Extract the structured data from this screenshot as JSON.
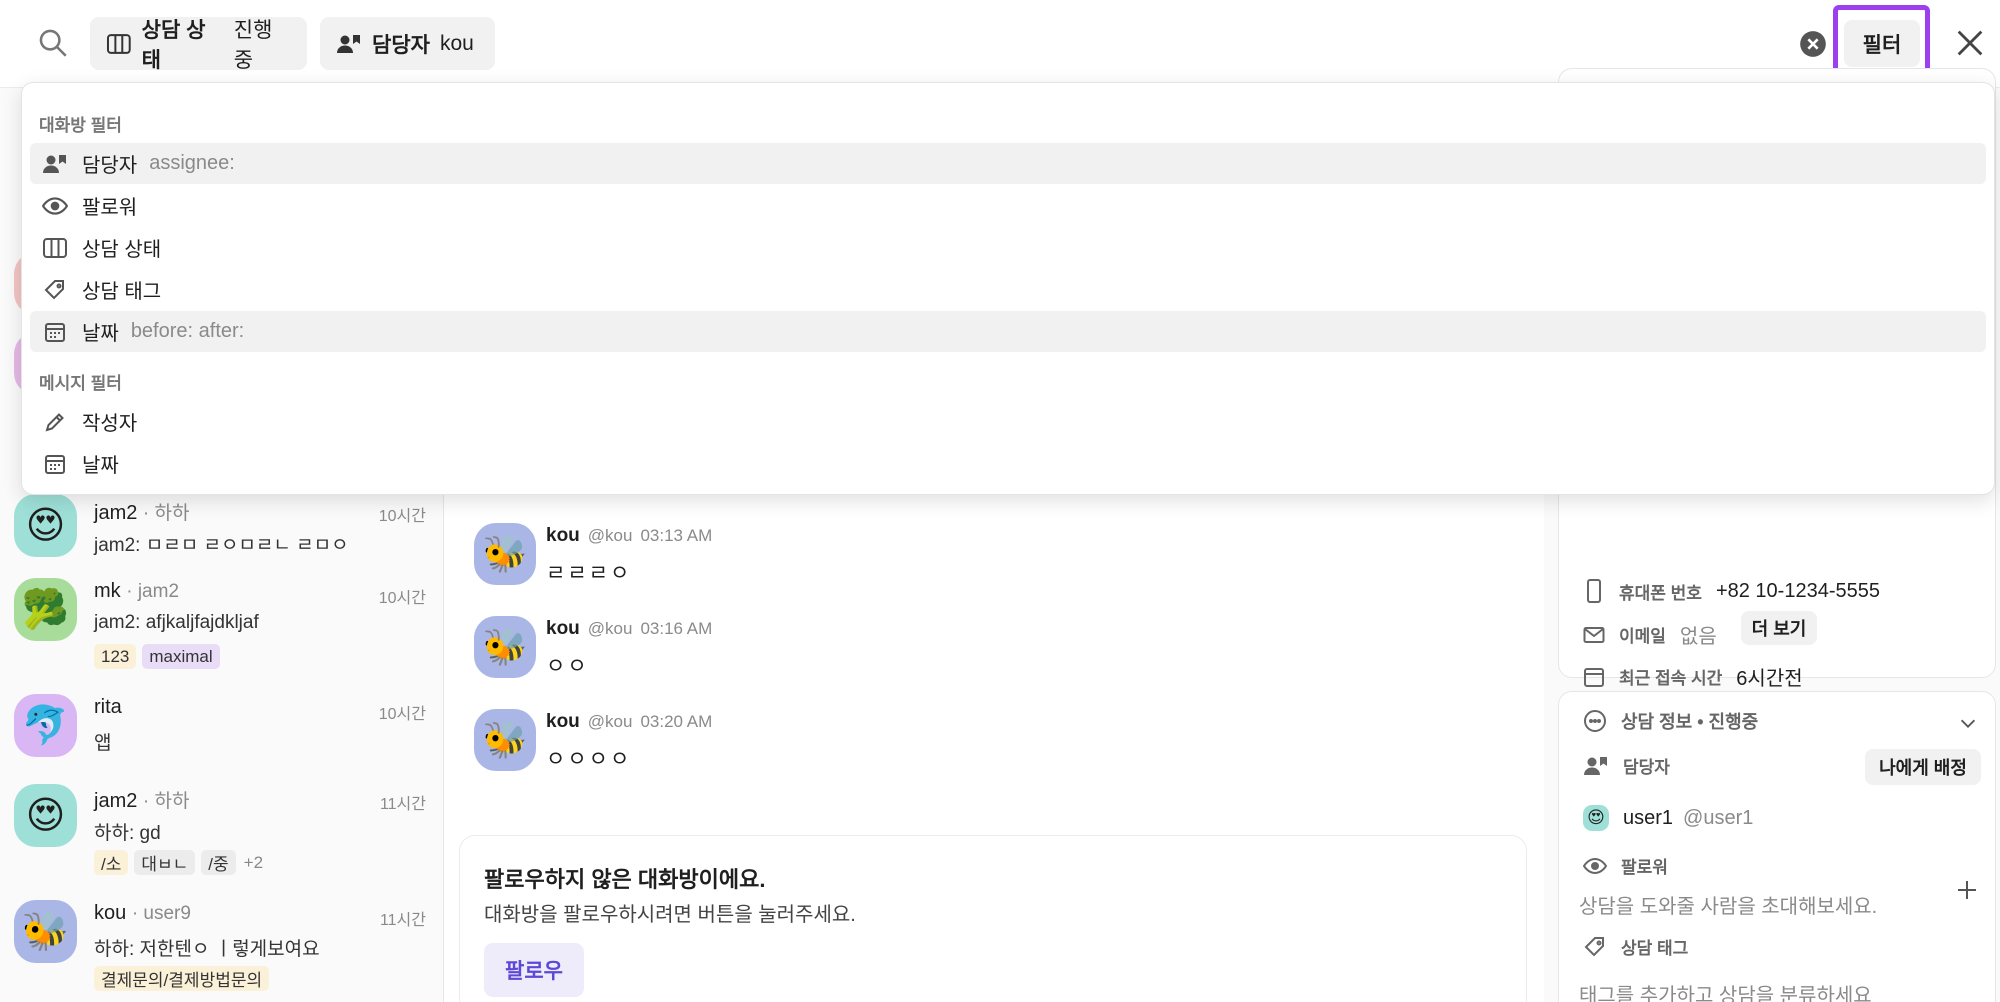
{
  "topbar": {
    "status_chip": {
      "key": "상담 상태",
      "value": "진행중"
    },
    "assignee_chip": {
      "key": "담당자",
      "value": "kou"
    },
    "filter_label": "필터"
  },
  "dropdown": {
    "room_section": "대화방 필터",
    "room_items": [
      {
        "label": "담당자",
        "hint": "assignee:"
      },
      {
        "label": "팔로워",
        "hint": ""
      },
      {
        "label": "상담 상태",
        "hint": ""
      },
      {
        "label": "상담 태그",
        "hint": ""
      },
      {
        "label": "날짜",
        "hint": "before: after:"
      }
    ],
    "message_section": "메시지 필터",
    "message_items": [
      {
        "label": "작성자"
      },
      {
        "label": "날짜"
      }
    ]
  },
  "conversations": [
    {
      "name": "jam2",
      "sub": "· 하하",
      "time": "10시간",
      "message": "jam2: ㅁㄹㅁ ㄹㅇㅁㄹㄴ ㄹㅁㅇ",
      "tags": []
    },
    {
      "name": "mk",
      "sub": "· jam2",
      "time": "10시간",
      "message": "jam2: afjkaljfajdkljaf",
      "tags": [
        "123",
        "maximal"
      ]
    },
    {
      "name": "rita",
      "sub": "",
      "time": "10시간",
      "message": "앱",
      "tags": []
    },
    {
      "name": "jam2",
      "sub": "· 하하",
      "time": "11시간",
      "message": "하하: gd",
      "tags": [
        "/소",
        "대ㅂㄴ",
        "/중",
        "+2"
      ]
    },
    {
      "name": "kou",
      "sub": "· user9",
      "time": "11시간",
      "message": "하하: 저한텐ㅇ ㅣ렇게보여요",
      "tags": [
        "결제문의/결제방법문의"
      ]
    }
  ],
  "messages": [
    {
      "author": "kou",
      "handle": "@kou",
      "time": "03:13 AM",
      "text": "ㄹㄹㄹㅇ"
    },
    {
      "author": "kou",
      "handle": "@kou",
      "time": "03:16 AM",
      "text": "ㅇㅇ"
    },
    {
      "author": "kou",
      "handle": "@kou",
      "time": "03:20 AM",
      "text": "ㅇㅇㅇㅇ"
    }
  ],
  "follow_card": {
    "title": "팔로우하지 않은 대화방이에요.",
    "desc": "대화방을 팔로우하시려면 버튼을 눌러주세요.",
    "button": "팔로우"
  },
  "profile": {
    "phone_label": "휴대폰 번호",
    "phone_value": "+82 10-1234-5555",
    "email_label": "이메일",
    "email_value": "없음",
    "last_seen_label": "최근 접속 시간",
    "last_seen_value": "6시간전",
    "more_button": "더 보기"
  },
  "consult_info": {
    "title": "상담 정보 • 진행중",
    "assignee_label": "담당자",
    "assign_me_button": "나에게 배정",
    "assignee_name": "user1",
    "assignee_handle": "@user1",
    "follower_label": "팔로워",
    "follower_hint": "상담을 도와줄 사람을 초대해보세요.",
    "tag_label": "상담 태그",
    "tag_hint": "태그를 추가하고 상담을 분류하세요"
  }
}
